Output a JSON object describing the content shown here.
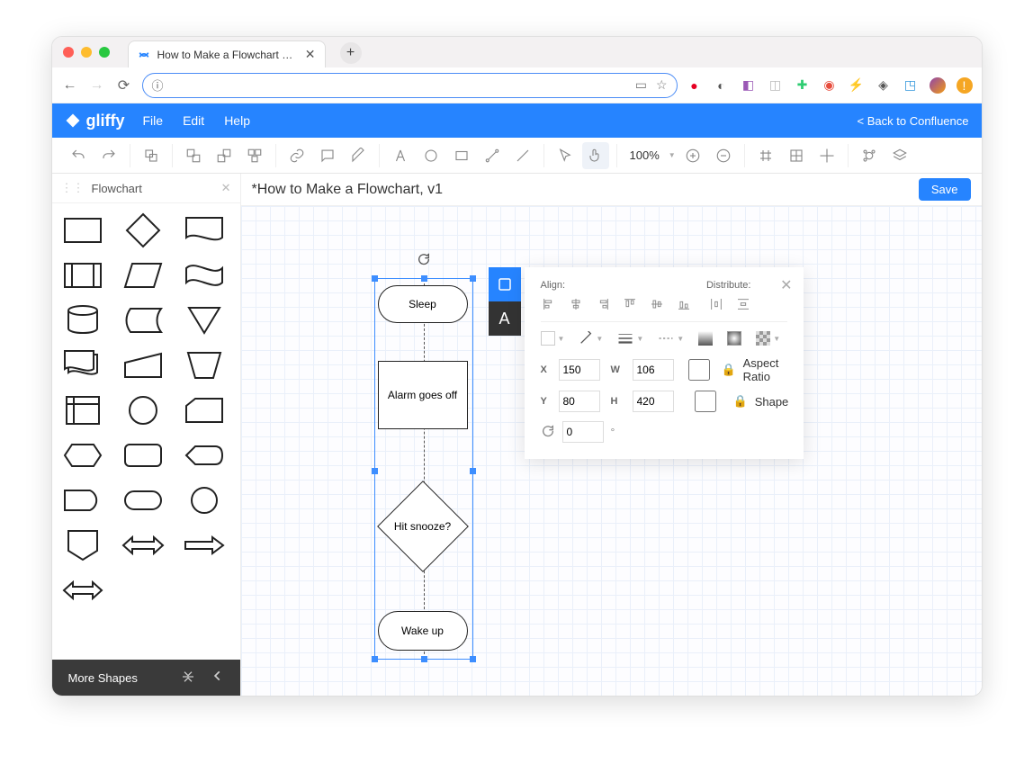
{
  "browser": {
    "tab_title": "How to Make a Flowchart with",
    "aria_new_tab": "+"
  },
  "app": {
    "logo": "gliffy",
    "menu": {
      "file": "File",
      "edit": "Edit",
      "help": "Help"
    },
    "back_link": "< Back to Confluence"
  },
  "toolbar": {
    "zoom": "100%"
  },
  "sidebar": {
    "panel_title": "Flowchart",
    "footer_label": "More Shapes"
  },
  "document": {
    "title": "*How to Make a Flowchart, v1",
    "save_label": "Save"
  },
  "canvas": {
    "nodes": {
      "sleep": "Sleep",
      "alarm": "Alarm goes off",
      "snooze": "Hit snooze?",
      "wake": "Wake up"
    }
  },
  "properties": {
    "align_label": "Align:",
    "distribute_label": "Distribute:",
    "x_label": "X",
    "x_value": "150",
    "y_label": "Y",
    "y_value": "80",
    "w_label": "W",
    "w_value": "106",
    "h_label": "H",
    "h_value": "420",
    "angle_value": "0",
    "degree": "°",
    "aspect_label": "Aspect Ratio",
    "shape_lock_label": "Shape"
  }
}
